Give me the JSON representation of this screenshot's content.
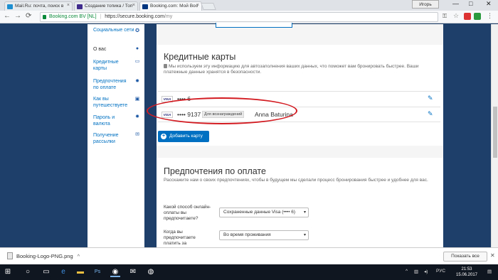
{
  "browser": {
    "tabs": [
      {
        "title": "Mail.Ru: почта, поиск в",
        "favicon_color": "#1e8fd1",
        "active": false
      },
      {
        "title": "Создание топика / Топ",
        "favicon_color": "#3f2c8c",
        "active": false
      },
      {
        "title": "Booking.com: Мой Boo",
        "favicon_color": "#003580",
        "active": true
      }
    ],
    "user_button": "Игорь",
    "window_controls": {
      "minimize": "—",
      "maximize": "□",
      "close": "✕"
    },
    "nav": {
      "back": "←",
      "forward": "→",
      "reload": "⟳"
    },
    "address": {
      "secure_label": "Booking.com BV [NL]",
      "separator": "|",
      "scheme_host": "https://secure.booking.com",
      "path": "/my"
    }
  },
  "sidebar": {
    "items": [
      {
        "label": "Социальные сети",
        "icon": "globe-icon",
        "glyph": "✪"
      },
      {
        "label": "О вас",
        "icon": "user-icon",
        "glyph": "●",
        "current": true
      },
      {
        "label": "Кредитные карты",
        "icon": "credit-card-icon",
        "glyph": "▭"
      },
      {
        "label": "Предпочтения по оплате",
        "icon": "settings-icon",
        "glyph": "✹"
      },
      {
        "label": "Как вы путешествуете",
        "icon": "suitcase-icon",
        "glyph": "▣"
      },
      {
        "label": "Пароль и валюта",
        "icon": "gear-icon",
        "glyph": "✹"
      },
      {
        "label": "Получение рассылки",
        "icon": "mail-icon",
        "glyph": "✉"
      }
    ]
  },
  "credit_cards": {
    "title": "Кредитные карты",
    "description": "Мы используем эту информацию для автозаполнения ваших данных, что поможет вам бронировать быстрее. Ваши платежные данные хранятся в безопасности.",
    "cards": [
      {
        "brand": "VISA",
        "number": "•••• 6",
        "badge": "",
        "holder": ""
      },
      {
        "brand": "VISA",
        "number": "•••• 9137",
        "badge": "Для вознаграждений",
        "holder": "Anna Baturina"
      }
    ],
    "add_button": "Добавить карту"
  },
  "payment_prefs": {
    "title": "Предпочтения по оплате",
    "description": "Расскажите нам о своих предпочтениях, чтобы в будущем мы сделали процесс бронирования быстрее и удобнее для вас.",
    "fields": [
      {
        "label": "Какой способ онлайн-оплаты вы предпочитаете?",
        "value": "Сохраненные данные Visa (•••• 6)"
      },
      {
        "label": "Когда вы предпочитаете платить за",
        "value": "Во время проживания"
      }
    ]
  },
  "download_bar": {
    "file_name": "Booking-Logo-PNG.png",
    "show_all": "Показать все",
    "close": "✕"
  },
  "taskbar": {
    "lang": "РУС",
    "time": "21:53",
    "date": "15.06.2017"
  },
  "colors": {
    "accent": "#0071c2",
    "page_bg": "#1f3f6b",
    "highlight": "#d31b22"
  }
}
